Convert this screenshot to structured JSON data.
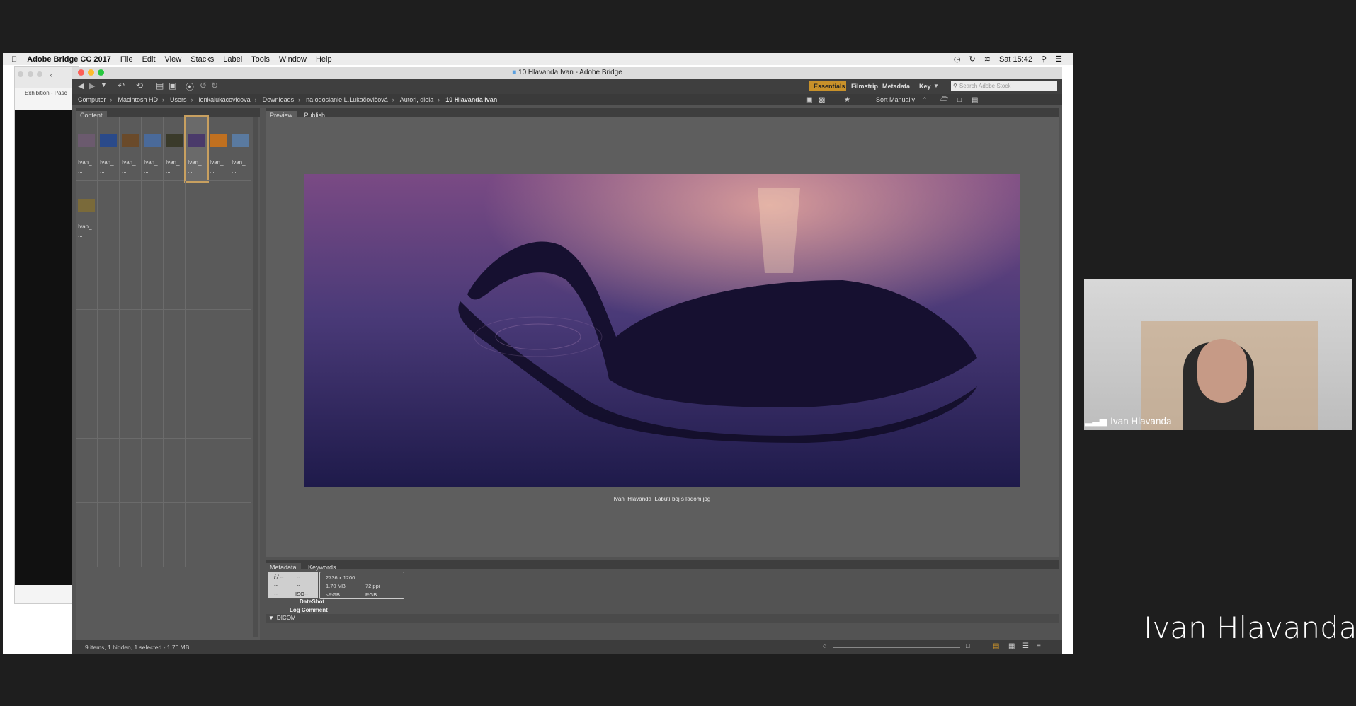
{
  "menubar": {
    "app": "Adobe Bridge CC 2017",
    "items": [
      "File",
      "Edit",
      "View",
      "Stacks",
      "Label",
      "Tools",
      "Window",
      "Help"
    ],
    "clock": "Sat 15:42"
  },
  "background_window": {
    "tab": "Exhibition - Pasc"
  },
  "window": {
    "title": "10 Hlavanda Ivan - Adobe Bridge"
  },
  "workspaces": {
    "essentials": "Essentials",
    "filmstrip": "Filmstrip",
    "metadata": "Metadata",
    "key": "Key",
    "search_placeholder": "Search Adobe Stock"
  },
  "path": [
    "Computer",
    "Macintosh HD",
    "Users",
    "lenkalukacovicova",
    "Downloads",
    "na odoslanie L.Lukačovičová",
    "Autori, diela",
    "10 Hlavanda Ivan"
  ],
  "sort": "Sort Manually",
  "content": {
    "tab": "Content",
    "thumb_label": "Ivan_",
    "thumb_sub": "...",
    "thumb_colors": [
      "#6b5a6e",
      "#2a4a8a",
      "#6a4a2a",
      "#4a6a9a",
      "#3a3a2a",
      "#4a3a6a",
      "#c07020",
      "#5a7aa0",
      "#7a6a3a"
    ]
  },
  "preview": {
    "tabs": [
      "Preview",
      "Publish"
    ],
    "filename": "Ivan_Hlavanda_Labutí boj s ľadom.jpg"
  },
  "metadata": {
    "tabs": [
      "Metadata",
      "Keywords"
    ],
    "camera": {
      "fstop": "f / --",
      "shutter": "--",
      "ev": "--",
      "wb": "--",
      "iso": "ISO--",
      "meter": "--"
    },
    "file": {
      "dimensions": "2736 x 1200",
      "size": "1.70 MB",
      "ppi": "72 ppi",
      "profile": "sRGB",
      "mode": "RGB"
    },
    "fields": [
      "DateShot",
      "Log Comment"
    ],
    "section": "DICOM"
  },
  "status": {
    "text": "9 items, 1 hidden, 1 selected - 1.70 MB"
  },
  "webcam": {
    "name": "Ivan Hlavanda"
  },
  "speaker_caption": "Ivan Hlavanda"
}
